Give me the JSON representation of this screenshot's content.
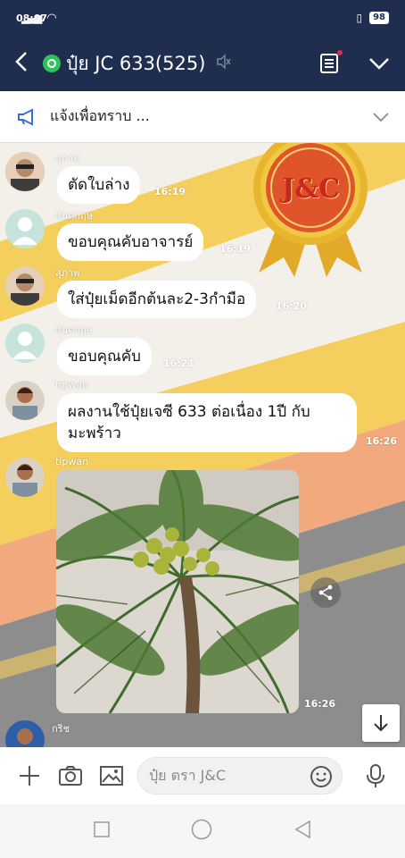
{
  "status": {
    "time": "08:07",
    "battery": "98"
  },
  "header": {
    "title": "ปุ๋ย JC 633(525)"
  },
  "announcement": {
    "text": "แจ้งเพื่อทราบ ..."
  },
  "messages": [
    {
      "name": "สุภาพ",
      "text": "ตัดใบล่าง",
      "time": "16:19"
    },
    {
      "name": "สันตกฤษ",
      "text": "ขอบคุณคับอาจารย์",
      "time": "16:19"
    },
    {
      "name": "สุภาพ",
      "text": "ใส่ปุ๋ยเม็ดอีกต้นละ2-3กำมือ",
      "time": "16:20"
    },
    {
      "name": "สันตกฤษ",
      "text": "ขอบคุณคับ",
      "time": "16:21"
    },
    {
      "name": "tipwan",
      "text_line1": "ผลงานใช้ปุ๋ยเจซี 633 ต่อเนื่อง 1ปี  กับ",
      "text_line2": "มะพร้าว",
      "time": "16:26"
    },
    {
      "name": "tipwan",
      "photo": "coconut-tree-photo",
      "time": "16:26"
    },
    {
      "name": "กริช"
    }
  ],
  "logo": {
    "text": "J&C"
  },
  "input": {
    "placeholder": "ปุ๋ย ตรา J&C"
  },
  "colors": {
    "header": "#1f2d4f",
    "online": "#2ec45a",
    "bubble": "#ffffff",
    "stripe_yellow": "#f4cf5e",
    "stripe_gray": "#8d8d8d",
    "stripe_peach": "#f2a97d"
  }
}
